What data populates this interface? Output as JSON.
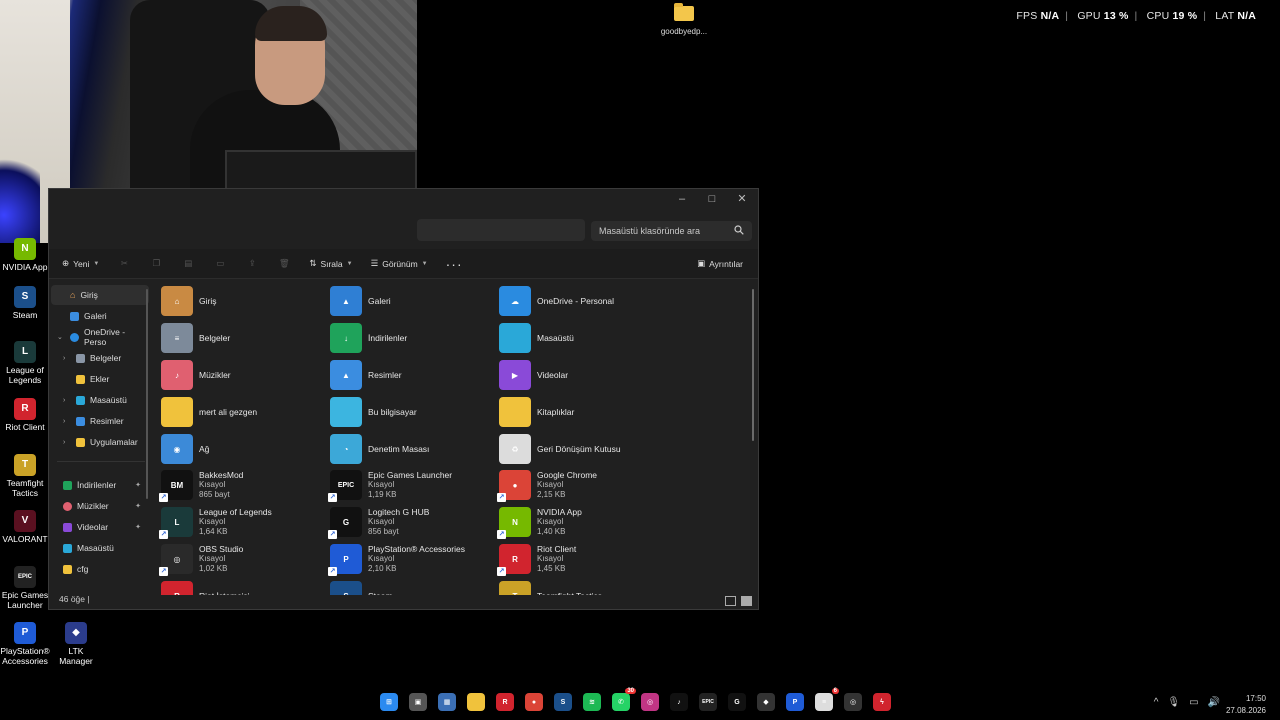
{
  "overlay": {
    "fps_label": "FPS",
    "fps_value": "N/A",
    "gpu_label": "GPU",
    "gpu_value": "13 %",
    "cpu_label": "CPU",
    "cpu_value": "19 %",
    "lat_label": "LAT",
    "lat_value": "N/A"
  },
  "desktop": {
    "file": "goodbyedp...",
    "icons": [
      {
        "label": "NVIDIA App",
        "color": "#76b900",
        "glyph": "N"
      },
      {
        "label": "Steam",
        "color": "#1b4f8a",
        "glyph": "S"
      },
      {
        "label": "League of Legends",
        "color": "#1a3a3a",
        "glyph": "L"
      },
      {
        "label": "Riot Client",
        "color": "#d1242e",
        "glyph": "R"
      },
      {
        "label": "Teamfight Tactics",
        "color": "#caa227",
        "glyph": "T"
      },
      {
        "label": "VALORANT",
        "color": "#5a1020",
        "glyph": "V"
      },
      {
        "label": "Epic Games Launcher",
        "color": "#222",
        "glyph": "EPIC"
      },
      {
        "label": "PlayStation® Accessories",
        "color": "#1f5bd6",
        "glyph": "P"
      },
      {
        "label": "LTK Manager",
        "color": "#2b3c8c",
        "glyph": "◆"
      }
    ]
  },
  "explorer": {
    "search_placeholder": "Masaüstü klasöründe ara",
    "toolbar": {
      "new_label": "Yeni",
      "sort_label": "Sırala",
      "view_label": "Görünüm",
      "more_label": "···",
      "details_label": "Ayrıntılar"
    },
    "nav": {
      "home": "Giriş",
      "gallery": "Galeri",
      "onedrive": "OneDrive - Perso",
      "docs": "Belgeler",
      "attachments": "Ekler",
      "desktop": "Masaüstü",
      "pictures": "Resimler",
      "apps": "Uygulamalar",
      "downloads": "İndirilenler",
      "music": "Müzikler",
      "videos": "Videolar",
      "desktop2": "Masaüstü",
      "cfg": "cfg"
    },
    "items": [
      {
        "name": "Giriş",
        "color": "#c98a43",
        "glyph": "⌂"
      },
      {
        "name": "Galeri",
        "color": "#2f7fd4",
        "glyph": "▲"
      },
      {
        "name": "OneDrive - Personal",
        "color": "#2a8be0",
        "glyph": "☁"
      },
      {
        "name": "Belgeler",
        "color": "#7d8a9a",
        "glyph": "≡"
      },
      {
        "name": "İndirilenler",
        "color": "#1fa35b",
        "glyph": "↓"
      },
      {
        "name": "Masaüstü",
        "color": "#2aa8d8",
        "glyph": ""
      },
      {
        "name": "Müzikler",
        "color": "#e06070",
        "glyph": "♪"
      },
      {
        "name": "Resimler",
        "color": "#3b8de0",
        "glyph": "▲"
      },
      {
        "name": "Videolar",
        "color": "#8a4ad8",
        "glyph": "▶"
      },
      {
        "name": "mert ali gezgen",
        "color": "#f0c23c",
        "glyph": ""
      },
      {
        "name": "Bu bilgisayar",
        "color": "#3cb5e0",
        "glyph": ""
      },
      {
        "name": "Kitaplıklar",
        "color": "#f0c23c",
        "glyph": ""
      },
      {
        "name": "Ağ",
        "color": "#3c8ad8",
        "glyph": "◉"
      },
      {
        "name": "Denetim Masası",
        "color": "#3ca8d8",
        "glyph": "◔"
      },
      {
        "name": "Geri Dönüşüm Kutusu",
        "color": "#dcdcdc",
        "glyph": "♻"
      },
      {
        "name": "BakkesMod",
        "type": "Kısayol",
        "size": "865 bayt",
        "color": "#111",
        "glyph": "BM"
      },
      {
        "name": "Epic Games Launcher",
        "type": "Kısayol",
        "size": "1,19 KB",
        "color": "#111",
        "glyph": "EPIC"
      },
      {
        "name": "Google Chrome",
        "type": "Kısayol",
        "size": "2,15 KB",
        "color": "#db4437",
        "glyph": "●"
      },
      {
        "name": "League of Legends",
        "type": "Kısayol",
        "size": "1,64 KB",
        "color": "#1a3a3a",
        "glyph": "L"
      },
      {
        "name": "Logitech G HUB",
        "type": "Kısayol",
        "size": "856 bayt",
        "color": "#111",
        "glyph": "G"
      },
      {
        "name": "NVIDIA App",
        "type": "Kısayol",
        "size": "1,40 KB",
        "color": "#76b900",
        "glyph": "N"
      },
      {
        "name": "OBS Studio",
        "type": "Kısayol",
        "size": "1,02 KB",
        "color": "#2a2a2a",
        "glyph": "◎"
      },
      {
        "name": "PlayStation® Accessories",
        "type": "Kısayol",
        "size": "2,10 KB",
        "color": "#1f5bd6",
        "glyph": "P"
      },
      {
        "name": "Riot Client",
        "type": "Kısayol",
        "size": "1,45 KB",
        "color": "#d1242e",
        "glyph": "R"
      },
      {
        "name": "Riot İstemcisi",
        "color": "#d1242e",
        "glyph": "R"
      },
      {
        "name": "Steam",
        "color": "#1b4f8a",
        "glyph": "S"
      },
      {
        "name": "Teamfight Tactics",
        "color": "#caa227",
        "glyph": "T"
      }
    ],
    "status": "46 öğe  |"
  },
  "taskbar": {
    "apps": [
      {
        "name": "start-button",
        "color": "#2b8af0",
        "glyph": "⊞"
      },
      {
        "name": "task-view",
        "color": "#555",
        "glyph": "▣"
      },
      {
        "name": "widgets",
        "color": "#3b6fb5",
        "glyph": "▦"
      },
      {
        "name": "file-explorer",
        "color": "#f0c23c",
        "glyph": ""
      },
      {
        "name": "riot-client",
        "color": "#d1242e",
        "glyph": "R"
      },
      {
        "name": "chrome",
        "color": "#db4437",
        "glyph": "●"
      },
      {
        "name": "steam",
        "color": "#1b4f8a",
        "glyph": "S"
      },
      {
        "name": "spotify",
        "color": "#1db954",
        "glyph": "≋"
      },
      {
        "name": "whatsapp",
        "color": "#25d366",
        "glyph": "✆",
        "badge": "30"
      },
      {
        "name": "instagram",
        "color": "#c13584",
        "glyph": "◎"
      },
      {
        "name": "tiktok",
        "color": "#111",
        "glyph": "♪"
      },
      {
        "name": "epic-games",
        "color": "#222",
        "glyph": "EPIC"
      },
      {
        "name": "logitech",
        "color": "#111",
        "glyph": "G"
      },
      {
        "name": "shield",
        "color": "#333",
        "glyph": "◆"
      },
      {
        "name": "playstation",
        "color": "#1f5bd6",
        "glyph": "P"
      },
      {
        "name": "notepad",
        "color": "#ddd",
        "glyph": "≡",
        "badge": "6"
      },
      {
        "name": "obs",
        "color": "#333",
        "glyph": "◎"
      },
      {
        "name": "lightning",
        "color": "#d1242e",
        "glyph": "ϟ"
      }
    ],
    "tray": [
      "^",
      "🎙",
      "▭",
      "🔊"
    ],
    "time": "17:50",
    "date": "27.08.2026"
  }
}
